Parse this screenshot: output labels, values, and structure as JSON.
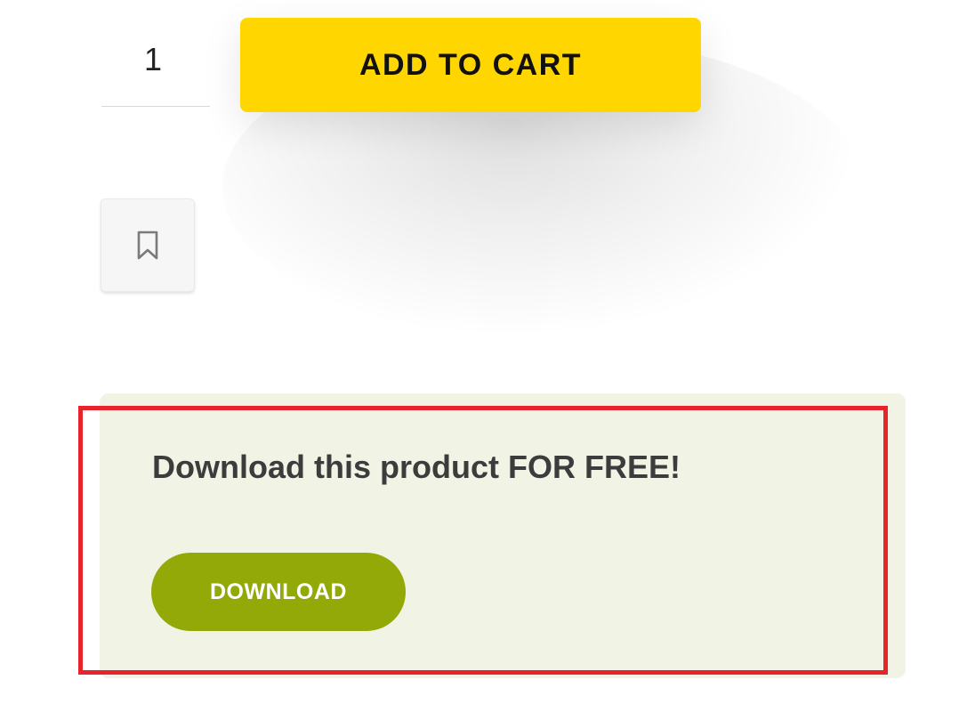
{
  "product_form": {
    "quantity": "1",
    "add_to_cart_label": "ADD TO CART",
    "wishlist_icon": "bookmark-icon"
  },
  "free_download": {
    "title": "Download this product FOR FREE!",
    "button_label": "DOWNLOAD"
  },
  "colors": {
    "add_to_cart_bg": "#FFD600",
    "promo_bg": "#F1F3E4",
    "download_button_bg": "#93A908",
    "highlight_border": "#E8232B"
  }
}
